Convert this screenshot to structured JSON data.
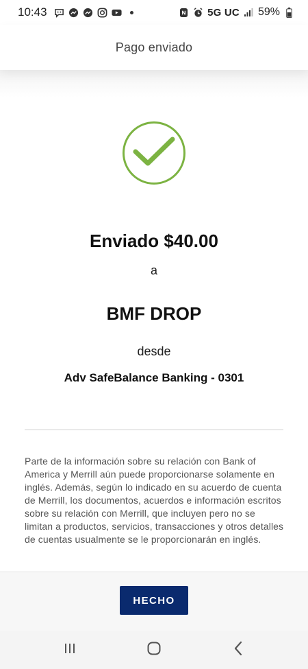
{
  "status_bar": {
    "time": "10:43",
    "network": "5G UC",
    "battery": "59%"
  },
  "header": {
    "title": "Pago enviado"
  },
  "confirmation": {
    "sent_amount": "Enviado $40.00",
    "to_word": "a",
    "recipient": "BMF DROP",
    "from_word": "desde",
    "account": "Adv SafeBalance Banking - 0301"
  },
  "disclaimer": "Parte de la información sobre su relación con Bank of America y Merrill aún puede proporcionarse solamente en inglés. Además, según lo indicado en su acuerdo de cuenta de Merrill, los documentos, acuerdos e información escritos sobre su relación con Merrill, que incluyen pero no se limitan a productos, servicios, transacciones y otros detalles de cuentas usualmente se le proporcionarán en inglés.",
  "footer": {
    "done_label": "HECHO"
  },
  "colors": {
    "success_green": "#7cb342",
    "button_navy": "#0a2a6e"
  },
  "icons": {
    "status_left": [
      "chat-bubble-icon",
      "messenger-icon",
      "messenger-icon",
      "instagram-icon",
      "youtube-icon"
    ],
    "status_right": [
      "nfc-icon",
      "alarm-icon",
      "signal-icon",
      "battery-icon"
    ],
    "success": "checkmark-circle-icon",
    "nav": [
      "recent-apps-icon",
      "home-icon",
      "back-icon"
    ]
  }
}
